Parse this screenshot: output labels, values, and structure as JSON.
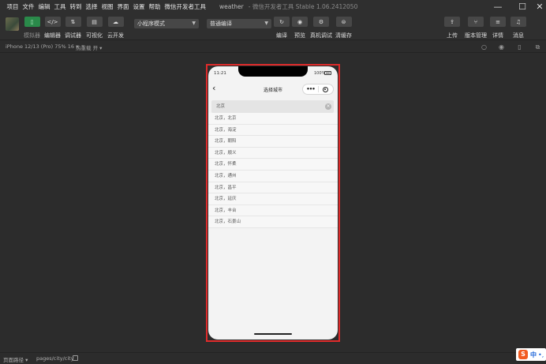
{
  "menu": [
    "项目",
    "文件",
    "编辑",
    "工具",
    "转到",
    "选择",
    "视图",
    "界面",
    "设置",
    "帮助",
    "微信开发者工具"
  ],
  "window": {
    "title": "weather",
    "subtitle": "- 微信开发者工具 Stable 1.06.2412050"
  },
  "toolbar": {
    "left_buttons": [
      {
        "label": "模拟器",
        "icon": "simulator-icon",
        "glyph": "▯",
        "active": true
      },
      {
        "label": "编辑器",
        "icon": "code-icon",
        "glyph": "</>"
      },
      {
        "label": "调试器",
        "icon": "debugger-icon",
        "glyph": "⇅"
      },
      {
        "label": "可视化",
        "icon": "visual-icon",
        "glyph": "▤"
      },
      {
        "label": "云开发",
        "icon": "cloud-icon",
        "glyph": "☁"
      }
    ],
    "mode_select": "小程序模式",
    "compile_select": "普通编译",
    "mid_buttons": [
      {
        "label": "编译",
        "icon": "refresh-icon",
        "glyph": "↻"
      },
      {
        "label": "预览",
        "icon": "eye-icon",
        "glyph": "◉"
      },
      {
        "label": "真机调试",
        "icon": "phone-debug-icon",
        "glyph": "⚙"
      },
      {
        "label": "清缓存",
        "icon": "clear-cache-icon",
        "glyph": "⊜"
      }
    ],
    "right_buttons": [
      {
        "label": "上传",
        "icon": "upload-icon",
        "glyph": "⇪"
      },
      {
        "label": "版本管理",
        "icon": "branch-icon",
        "glyph": "⑂"
      },
      {
        "label": "详情",
        "icon": "menu-icon",
        "glyph": "≡"
      },
      {
        "label": "消息",
        "icon": "bell-icon",
        "glyph": "♫"
      }
    ]
  },
  "subbar": {
    "device": "iPhone 12/13 (Pro) 75% 16 ▾",
    "hot_reload": "热重载 开 ▾"
  },
  "phone": {
    "time": "11:21",
    "battery": "100%",
    "nav_title": "选择城市",
    "search_value": "北京",
    "cities": [
      "北京，北京",
      "北京，海淀",
      "北京，朝阳",
      "北京，顺义",
      "北京，怀柔",
      "北京，通州",
      "北京，昌平",
      "北京，延庆",
      "北京，丰台",
      "北京，石景山"
    ]
  },
  "statusbar": {
    "path_label": "页面路径 ▾",
    "path": "pages/city/city"
  },
  "ime": {
    "logo": "S",
    "lang": "中",
    "punct": "•,"
  }
}
